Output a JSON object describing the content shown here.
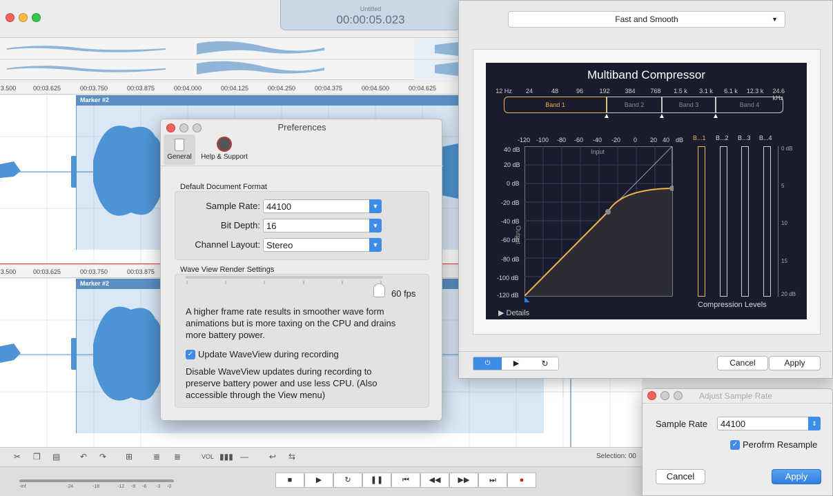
{
  "main": {
    "lcd_title": "Untitled",
    "lcd_time": "00:00:05.023",
    "ruler_labels": [
      "3.500",
      "00:03.625",
      "00:03.750",
      "00:03.875",
      "00:04.000",
      "00:04.125",
      "00:04.250",
      "00:04.375",
      "00:04.500",
      "00:04.625"
    ],
    "marker_label": "Marker #2",
    "selection_label": "Selection: 00",
    "vol_label": "VOL",
    "meter_labels": [
      "-inf",
      "-24",
      "-18",
      "-12",
      "-9",
      "-6",
      "-3",
      "-0"
    ],
    "colors": {
      "wave": "#4e94d4",
      "selection": "#d3e4f4",
      "marker": "#5b8fc4"
    }
  },
  "prefs": {
    "title": "Preferences",
    "tab_general": "General",
    "tab_help": "Help & Support",
    "section_format": "Default Document Format",
    "sample_rate_label": "Sample Rate:",
    "sample_rate_value": "44100",
    "bit_depth_label": "Bit Depth:",
    "bit_depth_value": "16",
    "channel_layout_label": "Channel Layout:",
    "channel_layout_value": "Stereo",
    "section_render": "Wave View Render Settings",
    "fps_value": "60 fps",
    "fps_slider_fraction": 1.0,
    "render_desc": "A higher frame rate results in smoother wave form animations but is more taxing on the CPU and drains more battery power.",
    "update_checkbox_label": "Update WaveView during recording",
    "update_checked": true,
    "disable_desc": "Disable WaveView updates during recording to preserve battery power and use less CPU. (Also accessible through the View menu)"
  },
  "compressor": {
    "preset": "Fast and Smooth",
    "title": "Multiband Compressor",
    "freq_labels": [
      "12 Hz",
      "24",
      "48",
      "96",
      "192",
      "384",
      "768",
      "1.5 k",
      "3.1 k",
      "6.1 k",
      "12.3 k",
      "24.6 kHz"
    ],
    "bands": [
      "Band 1",
      "Band 2",
      "Band 3",
      "Band 4"
    ],
    "input_db_labels": [
      "-120",
      "-100",
      "-80",
      "-60",
      "-40",
      "-20",
      "0",
      "20",
      "40",
      "dB"
    ],
    "output_db_labels": [
      "40 dB",
      "20 dB",
      "0 dB",
      "-20 dB",
      "-40 dB",
      "-60 dB",
      "-80 dB",
      "-100 dB",
      "-120 dB"
    ],
    "input_label": "Input",
    "output_label": "Output",
    "meter_headers": [
      "B...1",
      "B...2",
      "B...3",
      "B...4"
    ],
    "meter_scale": [
      "0 dB",
      "5",
      "10",
      "15",
      "20 dB"
    ],
    "levels_label": "Compression Levels",
    "details_label": "Details",
    "cancel": "Cancel",
    "apply": "Apply"
  },
  "sample_rate_dialog": {
    "title": "Adjust Sample Rate",
    "label": "Sample Rate",
    "value": "44100",
    "resample_label": "Perofrm Resample",
    "resample_checked": true,
    "cancel": "Cancel",
    "apply": "Apply"
  }
}
